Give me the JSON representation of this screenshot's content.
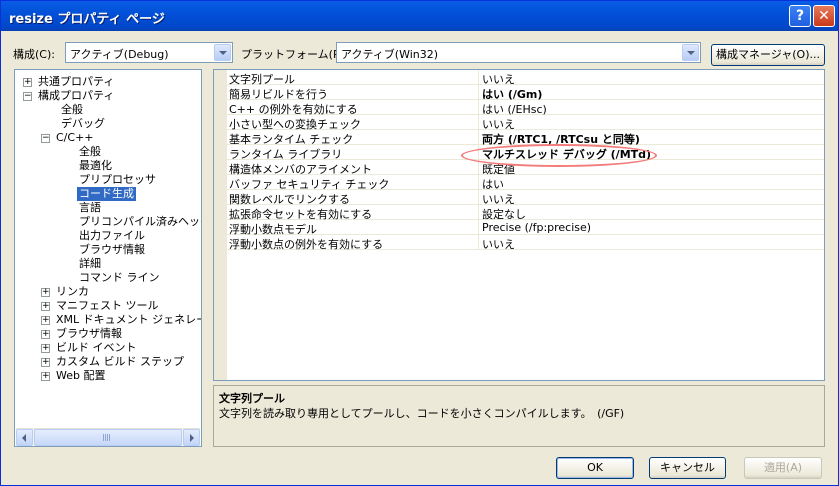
{
  "window": {
    "title": "resize プロパティ ページ"
  },
  "title_buttons": {
    "help": "?",
    "close": "✕"
  },
  "config": {
    "label": "構成(C):",
    "value": "アクティブ(Debug)"
  },
  "platform": {
    "label": "プラットフォーム(P):",
    "value": "アクティブ(Win32)"
  },
  "config_manager_button": "構成マネージャ(O)...",
  "tree": [
    {
      "label": "共通プロパティ",
      "expander": "+"
    },
    {
      "label": "構成プロパティ",
      "expander": "−"
    },
    {
      "label": "全般"
    },
    {
      "label": "デバッグ"
    },
    {
      "label": "C/C++",
      "expander": "−"
    },
    {
      "label": "全般"
    },
    {
      "label": "最適化"
    },
    {
      "label": "プリプロセッサ"
    },
    {
      "label": "コード生成",
      "selected": true
    },
    {
      "label": "言語"
    },
    {
      "label": "プリコンパイル済みヘッダー"
    },
    {
      "label": "出力ファイル"
    },
    {
      "label": "ブラウザ情報"
    },
    {
      "label": "詳細"
    },
    {
      "label": "コマンド ライン"
    },
    {
      "label": "リンカ",
      "expander": "+"
    },
    {
      "label": "マニフェスト ツール",
      "expander": "+"
    },
    {
      "label": "XML ドキュメント ジェネレータ",
      "expander": "+"
    },
    {
      "label": "ブラウザ情報",
      "expander": "+"
    },
    {
      "label": "ビルド イベント",
      "expander": "+"
    },
    {
      "label": "カスタム ビルド ステップ",
      "expander": "+"
    },
    {
      "label": "Web 配置",
      "expander": "+"
    }
  ],
  "properties": [
    {
      "name": "文字列プール",
      "value": "いいえ",
      "bold": false
    },
    {
      "name": "簡易リビルドを行う",
      "value": "はい (/Gm)",
      "bold": true
    },
    {
      "name": "C++ の例外を有効にする",
      "value": "はい (/EHsc)",
      "bold": false
    },
    {
      "name": "小さい型への変換チェック",
      "value": "いいえ",
      "bold": false
    },
    {
      "name": "基本ランタイム チェック",
      "value": "両方 (/RTC1, /RTCsu と同等)",
      "bold": true
    },
    {
      "name": "ランタイム ライブラリ",
      "value": "マルチスレッド デバッグ (/MTd)",
      "bold": true
    },
    {
      "name": "構造体メンバのアライメント",
      "value": "既定値",
      "bold": false
    },
    {
      "name": "バッファ セキュリティ チェック",
      "value": "はい",
      "bold": false
    },
    {
      "name": "関数レベルでリンクする",
      "value": "いいえ",
      "bold": false
    },
    {
      "name": "拡張命令セットを有効にする",
      "value": "設定なし",
      "bold": false
    },
    {
      "name": "浮動小数点モデル",
      "value": "Precise (/fp:precise)",
      "bold": false
    },
    {
      "name": "浮動小数点の例外を有効にする",
      "value": "いいえ",
      "bold": false
    }
  ],
  "description": {
    "title": "文字列プール",
    "text": "文字列を読み取り専用としてプールし、コードを小さくコンパイルします。　(/GF)"
  },
  "buttons": {
    "ok": "OK",
    "cancel": "キャンセル",
    "apply": "適用(A)"
  },
  "colors": {
    "title_bar": "#0054e3",
    "selection": "#316ac5",
    "highlight_ellipse": "#f47b7b",
    "dialog_bg": "#ece9d8"
  }
}
